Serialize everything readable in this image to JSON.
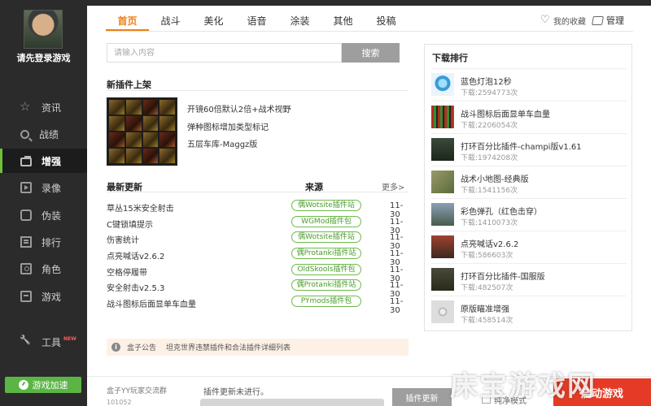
{
  "sidebar": {
    "login_text": "请先登录游戏",
    "items": [
      {
        "label": "资讯",
        "icon": "star-icon"
      },
      {
        "label": "战绩",
        "icon": "search-icon"
      },
      {
        "label": "增强",
        "icon": "toolbox-icon"
      },
      {
        "label": "录像",
        "icon": "video-icon"
      },
      {
        "label": "伪装",
        "icon": "disguise-icon"
      },
      {
        "label": "排行",
        "icon": "ranking-icon"
      },
      {
        "label": "角色",
        "icon": "person-icon"
      },
      {
        "label": "游戏",
        "icon": "game-icon"
      }
    ],
    "tools_label": "工具",
    "tools_badge": "NEW",
    "speed_button": "游戏加速"
  },
  "header": {
    "tabs": [
      "首页",
      "战斗",
      "美化",
      "语音",
      "涂装",
      "其他",
      "投稿"
    ],
    "favorites": "我的收藏",
    "manage": "管理"
  },
  "search": {
    "placeholder": "请输入内容",
    "button": "搜索"
  },
  "new_plugins": {
    "title": "新插件上架",
    "items": [
      "开镜60倍默认2倍+战术视野",
      "弹种图标增加类型标记",
      "五层车库-Maggz版"
    ]
  },
  "updates": {
    "title": "最新更新",
    "source_header": "来源",
    "more": "更多>",
    "rows": [
      {
        "name": "草丛15米安全射击",
        "source": "偶Wotsite插件站",
        "date": "11-30"
      },
      {
        "name": "C键锁填提示",
        "source": "WGMod插件包",
        "date": "11-30"
      },
      {
        "name": "伤害统计",
        "source": "偶Wotsite插件站",
        "date": "11-30"
      },
      {
        "name": "点亮喊话v2.6.2",
        "source": "偶Protanki插件站",
        "date": "11-30"
      },
      {
        "name": "空格停履带",
        "source": "OldSkools插件包",
        "date": "11-30"
      },
      {
        "name": "安全射击v2.5.3",
        "source": "偶Protanki插件站",
        "date": "11-30"
      },
      {
        "name": "战斗图标后面显单车血量",
        "source": "PYmods插件包",
        "date": "11-30"
      }
    ]
  },
  "notice": {
    "label": "盒子公告",
    "text": "坦克世界违禁插件和合法插件详细列表"
  },
  "downloads": {
    "title": "下载排行",
    "items": [
      {
        "name": "蓝色灯泡12秒",
        "count": "下载:2594773次"
      },
      {
        "name": "战斗图标后面显单车血量",
        "count": "下载:2206054次"
      },
      {
        "name": "打环百分比插件-champi版v1.61",
        "count": "下载:1974208次"
      },
      {
        "name": "战术小地图-经典版",
        "count": "下载:1541156次"
      },
      {
        "name": "彩色弹孔（红色击穿）",
        "count": "下载:1410073次"
      },
      {
        "name": "点亮喊话v2.6.2",
        "count": "下载:586603次"
      },
      {
        "name": "打环百分比插件-国服版",
        "count": "下载:482507次"
      },
      {
        "name": "原版瞄准增强",
        "count": "下载:458514次"
      }
    ]
  },
  "bottom": {
    "qq_group": "盒子YY玩家交流群",
    "qq_number": "101052",
    "update_status": "插件更新未进行。",
    "update_button": "插件更新",
    "pure_mode": "纯净模式",
    "launch_button": "启动游戏",
    "watermark": "床宝游戏网"
  },
  "colors": {
    "accent": "#ef7f17",
    "green": "#5bb545",
    "launch": "#e53b26",
    "sidebar_bg": "#2b2b2b"
  }
}
